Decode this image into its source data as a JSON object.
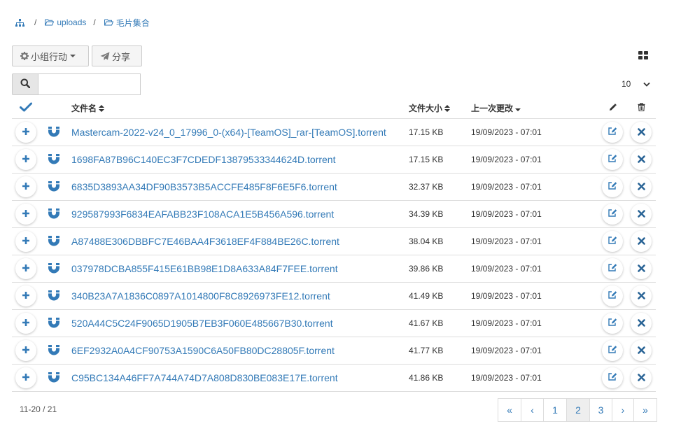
{
  "breadcrumb": {
    "root_icon": "sitemap-icon",
    "items": [
      {
        "label": "uploads",
        "icon": "folder-open-icon"
      },
      {
        "label": "毛片集合",
        "icon": "folder-open-icon"
      }
    ],
    "separator": "/"
  },
  "toolbar": {
    "group_action_label": "小组行动",
    "share_label": "分享"
  },
  "search": {
    "value": "",
    "placeholder": ""
  },
  "page_size": "10",
  "table": {
    "headers": {
      "name": "文件名",
      "size": "文件大小",
      "modified": "上一次更改"
    },
    "rows": [
      {
        "name": "Mastercam-2022-v24_0_17996_0-(x64)-[TeamOS]_rar-[TeamOS].torrent",
        "size": "17.15 KB",
        "modified": "19/09/2023 - 07:01"
      },
      {
        "name": "1698FA87B96C140EC3F7CDEDF13879533344624D.torrent",
        "size": "17.15 KB",
        "modified": "19/09/2023 - 07:01"
      },
      {
        "name": "6835D3893AA34DF90B3573B5ACCFE485F8F6E5F6.torrent",
        "size": "32.37 KB",
        "modified": "19/09/2023 - 07:01"
      },
      {
        "name": "929587993F6834EAFABB23F108ACA1E5B456A596.torrent",
        "size": "34.39 KB",
        "modified": "19/09/2023 - 07:01"
      },
      {
        "name": "A87488E306DBBFC7E46BAA4F3618EF4F884BE26C.torrent",
        "size": "38.04 KB",
        "modified": "19/09/2023 - 07:01"
      },
      {
        "name": "037978DCBA855F415E61BB98E1D8A633A84F7FEE.torrent",
        "size": "39.86 KB",
        "modified": "19/09/2023 - 07:01"
      },
      {
        "name": "340B23A7A1836C0897A1014800F8C8926973FE12.torrent",
        "size": "41.49 KB",
        "modified": "19/09/2023 - 07:01"
      },
      {
        "name": "520A44C5C24F9065D1905B7EB3F060E485667B30.torrent",
        "size": "41.67 KB",
        "modified": "19/09/2023 - 07:01"
      },
      {
        "name": "6EF2932A0A4CF90753A1590C6A50FB80DC28805F.torrent",
        "size": "41.77 KB",
        "modified": "19/09/2023 - 07:01"
      },
      {
        "name": "C95BC134A46FF7A744A74D7A808D830BE083E17E.torrent",
        "size": "41.86 KB",
        "modified": "19/09/2023 - 07:01"
      }
    ]
  },
  "footer": {
    "count": "11-20 / 21"
  },
  "pagination": {
    "first": "«",
    "prev": "‹",
    "pages": [
      "1",
      "2",
      "3"
    ],
    "active": "2",
    "next": "›",
    "last": "»"
  },
  "colors": {
    "link": "#337ab7",
    "add": "#337ab7",
    "magnet": "#337ab7",
    "edit": "#337ab7",
    "delete": "#2a6496"
  }
}
